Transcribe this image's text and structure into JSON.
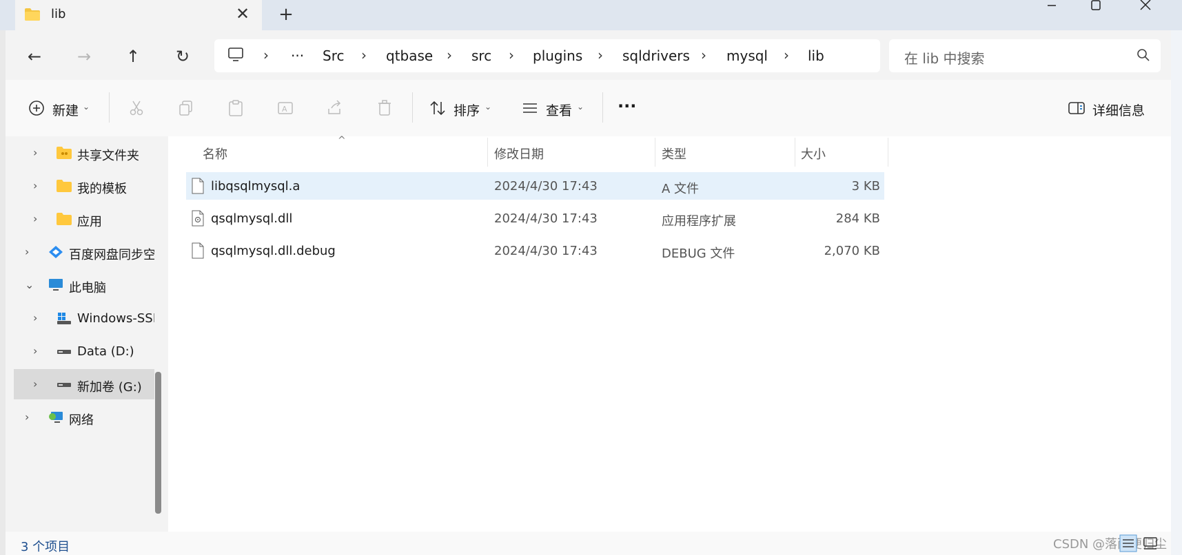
{
  "window": {
    "tab_title": "lib",
    "new_tab": "+",
    "close_tab": "✕"
  },
  "nav": {
    "back": "←",
    "forward": "→",
    "up": "↑",
    "refresh": "↻"
  },
  "breadcrumb": {
    "overflow": "···",
    "items": [
      "Src",
      "qtbase",
      "src",
      "plugins",
      "sqldrivers",
      "mysql",
      "lib"
    ]
  },
  "search": {
    "placeholder": "在 lib 中搜索"
  },
  "toolbar": {
    "new_label": "新建",
    "sort_label": "排序",
    "view_label": "查看",
    "more_label": "···",
    "details_label": "详细信息"
  },
  "sidebar": {
    "items": [
      {
        "label": "共享文件夹",
        "icon": "shared-folder-icon"
      },
      {
        "label": "我的模板",
        "icon": "folder-icon"
      },
      {
        "label": "应用",
        "icon": "folder-icon"
      },
      {
        "label": "百度网盘同步空间",
        "icon": "baidu-netdisk-icon"
      },
      {
        "label": "此电脑",
        "icon": "this-pc-icon"
      },
      {
        "label": "Windows-SSD",
        "icon": "windows-drive-icon"
      },
      {
        "label": "Data (D:)",
        "icon": "drive-icon"
      },
      {
        "label": "新加卷 (G:)",
        "icon": "drive-icon"
      },
      {
        "label": "网络",
        "icon": "network-icon"
      }
    ]
  },
  "columns": {
    "name": "名称",
    "modified": "修改日期",
    "type": "类型",
    "size": "大小"
  },
  "files": [
    {
      "name": "libqsqlmysql.a",
      "modified": "2024/4/30 17:43",
      "type": "A 文件",
      "size": "3 KB"
    },
    {
      "name": "qsqlmysql.dll",
      "modified": "2024/4/30 17:43",
      "type": "应用程序扩展",
      "size": "284 KB"
    },
    {
      "name": "qsqlmysql.dll.debug",
      "modified": "2024/4/30 17:43",
      "type": "DEBUG 文件",
      "size": "2,070 KB"
    }
  ],
  "status": {
    "count": "3 个项目"
  },
  "watermark": "CSDN @落雨便归尘"
}
